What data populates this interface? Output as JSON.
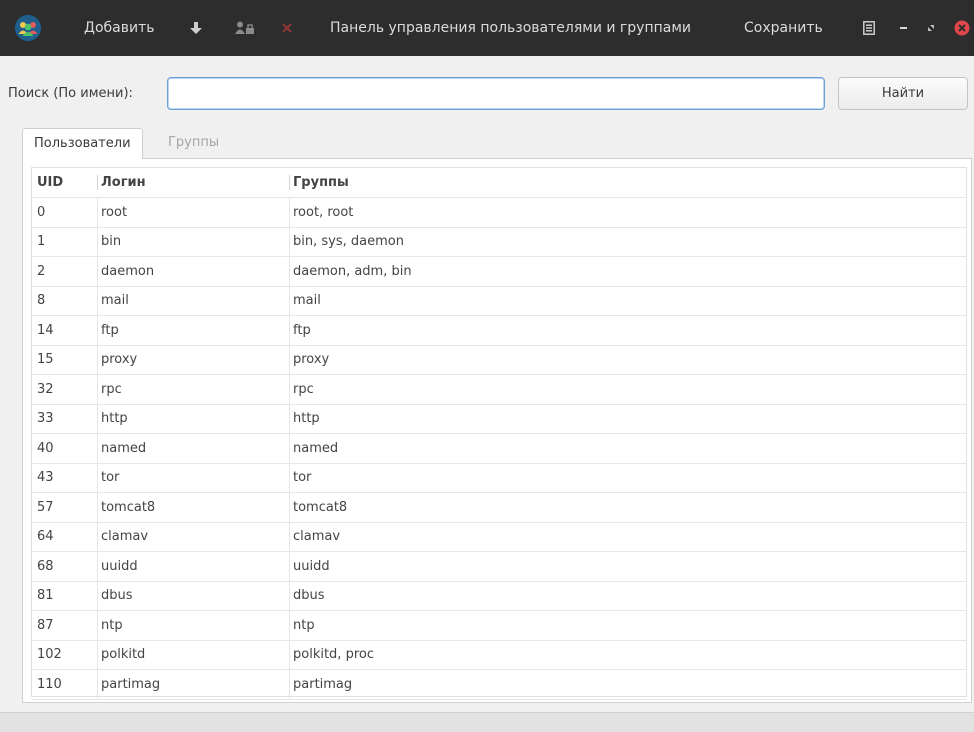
{
  "window": {
    "title": "Панель управления пользователями и группами",
    "accent": "#6aa0d8",
    "header_bg": "#2d2d2d",
    "close_color": "#e0464b"
  },
  "toolbar": {
    "add_label": "Добавить",
    "save_label": "Сохранить",
    "icons": [
      "download-icon",
      "user-lock-icon",
      "delete-icon",
      "menu-icon",
      "minimize-icon",
      "restore-icon",
      "close-icon"
    ]
  },
  "search": {
    "label": "Поиск (По имени):",
    "value": "",
    "placeholder": "",
    "button_label": "Найти"
  },
  "tabs": [
    {
      "label": "Пользователи",
      "active": true
    },
    {
      "label": "Группы",
      "active": false
    }
  ],
  "table": {
    "columns": [
      "UID",
      "Логин",
      "Группы"
    ],
    "rows": [
      {
        "uid": "0",
        "login": "root",
        "groups": "root, root"
      },
      {
        "uid": "1",
        "login": "bin",
        "groups": "bin, sys, daemon"
      },
      {
        "uid": "2",
        "login": "daemon",
        "groups": "daemon, adm, bin"
      },
      {
        "uid": "8",
        "login": "mail",
        "groups": "mail"
      },
      {
        "uid": "14",
        "login": "ftp",
        "groups": "ftp"
      },
      {
        "uid": "15",
        "login": "proxy",
        "groups": "proxy"
      },
      {
        "uid": "32",
        "login": "rpc",
        "groups": "rpc"
      },
      {
        "uid": "33",
        "login": "http",
        "groups": "http"
      },
      {
        "uid": "40",
        "login": "named",
        "groups": "named"
      },
      {
        "uid": "43",
        "login": "tor",
        "groups": "tor"
      },
      {
        "uid": "57",
        "login": "tomcat8",
        "groups": "tomcat8"
      },
      {
        "uid": "64",
        "login": "clamav",
        "groups": "clamav"
      },
      {
        "uid": "68",
        "login": "uuidd",
        "groups": "uuidd"
      },
      {
        "uid": "81",
        "login": "dbus",
        "groups": "dbus"
      },
      {
        "uid": "87",
        "login": "ntp",
        "groups": "ntp"
      },
      {
        "uid": "102",
        "login": "polkitd",
        "groups": "polkitd, proc"
      },
      {
        "uid": "110",
        "login": "partimag",
        "groups": "partimag"
      }
    ]
  }
}
